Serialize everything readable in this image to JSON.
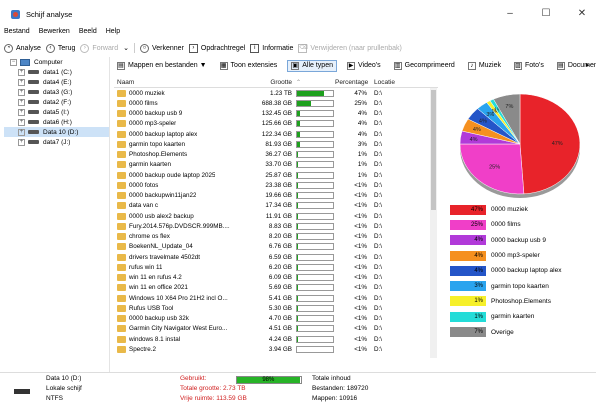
{
  "window": {
    "title": "Schijf analyse",
    "controls": [
      "–",
      "☐",
      "✕"
    ]
  },
  "menu": [
    "Bestand",
    "Bewerken",
    "Beeld",
    "Help"
  ],
  "toolbar": {
    "analyse": "Analyse",
    "back": "Terug",
    "forward": "Forward",
    "explorer": "Verkenner",
    "cmd": "Opdrachtregel",
    "info": "Informatie",
    "delete": "Verwijderen (naar prullenbak)"
  },
  "tree": {
    "root": "Computer",
    "drives": [
      "data1 (C:)",
      "data4 (E:)",
      "data3 (G:)",
      "data2 (F:)",
      "data5 (I:)",
      "data6 (H:)",
      "Data 10 (D:)",
      "data7 (J:)"
    ],
    "selected_index": 6
  },
  "tabs": [
    {
      "icon": "folders-icon",
      "label": "Mappen en bestanden ▼"
    },
    {
      "icon": "extensions-icon",
      "label": "Toon extensies"
    },
    {
      "icon": "all-types-icon",
      "label": "Alle typen"
    },
    {
      "icon": "video-icon",
      "label": "Video's"
    },
    {
      "icon": "compressed-icon",
      "label": "Gecomprimeerd"
    },
    {
      "icon": "music-icon",
      "label": "Muziek"
    },
    {
      "icon": "photo-icon",
      "label": "Foto's"
    },
    {
      "icon": "documents-icon",
      "label": "Documenten"
    }
  ],
  "tabs_overflow": "▸",
  "columns": {
    "name": "Naam",
    "size": "Grootte",
    "pct": "Percentage",
    "loc": "Locatie"
  },
  "rows": [
    {
      "name": "0000 muziek",
      "size": "1.23 TB",
      "pct": "47%",
      "fill": 0.47,
      "loc": "D:\\"
    },
    {
      "name": "0000 films",
      "size": "688.38 GB",
      "pct": "25%",
      "fill": 0.25,
      "loc": "D:\\"
    },
    {
      "name": "0000 backup usb 9",
      "size": "132.45 GB",
      "pct": "4%",
      "fill": 0.04,
      "loc": "D:\\"
    },
    {
      "name": "0000 mp3-speler",
      "size": "125.66 GB",
      "pct": "4%",
      "fill": 0.04,
      "loc": "D:\\"
    },
    {
      "name": "0000 backup laptop alex",
      "size": "122.34 GB",
      "pct": "4%",
      "fill": 0.04,
      "loc": "D:\\"
    },
    {
      "name": "garmin topo kaarten",
      "size": "81.93 GB",
      "pct": "3%",
      "fill": 0.03,
      "loc": "D:\\"
    },
    {
      "name": "Photoshop.Elements",
      "size": "36.27 GB",
      "pct": "1%",
      "fill": 0.01,
      "loc": "D:\\"
    },
    {
      "name": "garmin kaarten",
      "size": "33.70 GB",
      "pct": "1%",
      "fill": 0.01,
      "loc": "D:\\"
    },
    {
      "name": "0000 backup oude laptop 2025",
      "size": "25.87 GB",
      "pct": "1%",
      "fill": 0.01,
      "loc": "D:\\"
    },
    {
      "name": "0000 fotos",
      "size": "23.38 GB",
      "pct": "<1%",
      "fill": 0.005,
      "loc": "D:\\"
    },
    {
      "name": "0000 backupwin11jan22",
      "size": "19.66 GB",
      "pct": "<1%",
      "fill": 0.005,
      "loc": "D:\\"
    },
    {
      "name": "data van c",
      "size": "17.34 GB",
      "pct": "<1%",
      "fill": 0.005,
      "loc": "D:\\"
    },
    {
      "name": "0000 usb alex2 backup",
      "size": "11.91 GB",
      "pct": "<1%",
      "fill": 0.004,
      "loc": "D:\\"
    },
    {
      "name": "Fury.2014.576p.DVDSCR.999MB....",
      "size": "8.83 GB",
      "pct": "<1%",
      "fill": 0.003,
      "loc": "D:\\"
    },
    {
      "name": "chrome os flex",
      "size": "8.20 GB",
      "pct": "<1%",
      "fill": 0.003,
      "loc": "D:\\"
    },
    {
      "name": "BoekenNL_Update_04",
      "size": "6.76 GB",
      "pct": "<1%",
      "fill": 0.002,
      "loc": "D:\\"
    },
    {
      "name": "drivers travelmate 4502dt",
      "size": "6.59 GB",
      "pct": "<1%",
      "fill": 0.002,
      "loc": "D:\\"
    },
    {
      "name": "rufus win 11",
      "size": "6.20 GB",
      "pct": "<1%",
      "fill": 0.002,
      "loc": "D:\\"
    },
    {
      "name": "win 11 en rufus 4.2",
      "size": "6.09 GB",
      "pct": "<1%",
      "fill": 0.002,
      "loc": "D:\\"
    },
    {
      "name": "win 11 en office 2021",
      "size": "5.69 GB",
      "pct": "<1%",
      "fill": 0.002,
      "loc": "D:\\"
    },
    {
      "name": "Windows 10 X64 Pro 21H2 incl O...",
      "size": "5.41 GB",
      "pct": "<1%",
      "fill": 0.002,
      "loc": "D:\\"
    },
    {
      "name": "Rufus USB Tool",
      "size": "5.30 GB",
      "pct": "<1%",
      "fill": 0.002,
      "loc": "D:\\"
    },
    {
      "name": "0000 backup usb 32k",
      "size": "4.70 GB",
      "pct": "<1%",
      "fill": 0.002,
      "loc": "D:\\"
    },
    {
      "name": "Garmin City Navigator West Euro...",
      "size": "4.51 GB",
      "pct": "<1%",
      "fill": 0.002,
      "loc": "D:\\"
    },
    {
      "name": "windows 8.1 instal",
      "size": "4.24 GB",
      "pct": "<1%",
      "fill": 0.002,
      "loc": "D:\\"
    },
    {
      "name": "Spectre.2",
      "size": "3.94 GB",
      "pct": "<1%",
      "fill": 0.001,
      "loc": "D:\\"
    }
  ],
  "chart_data": {
    "type": "pie",
    "slices": [
      {
        "label": "0000 muziek",
        "value": 47,
        "color": "#e8232a",
        "pct": "47%"
      },
      {
        "label": "0000 films",
        "value": 25,
        "color": "#f03fc8",
        "pct": "25%"
      },
      {
        "label": "0000 backup usb 9",
        "value": 4,
        "color": "#b13ad9",
        "pct": "4%"
      },
      {
        "label": "0000 mp3-speler",
        "value": 4,
        "color": "#f5901f",
        "pct": "4%"
      },
      {
        "label": "0000 backup laptop alex",
        "value": 4,
        "color": "#2455c8",
        "pct": "4%"
      },
      {
        "label": "garmin topo kaarten",
        "value": 3,
        "color": "#2aa4ee",
        "pct": "3%"
      },
      {
        "label": "Photoshop.Elements",
        "value": 1,
        "color": "#f6f02a",
        "pct": "1%"
      },
      {
        "label": "garmin kaarten",
        "value": 1,
        "color": "#23dcd8",
        "pct": "1%"
      },
      {
        "label": "Overige",
        "value": 7,
        "color": "#8a8a8a",
        "pct": "7%"
      }
    ]
  },
  "status": {
    "drive_name": "Data 10 (D:)",
    "drive_type": "Lokale schijf",
    "fs": "NTFS",
    "used_label": "Gebruikt:",
    "used_pct": "98%",
    "used_fill": 0.98,
    "total_size": "Totale grootte: 2.73 TB",
    "free_space": "Vrije ruimte: 113.59 GB",
    "total_content": "Totale inhoud",
    "files": "Bestanden: 189720",
    "folders": "Mappen: 10916"
  }
}
